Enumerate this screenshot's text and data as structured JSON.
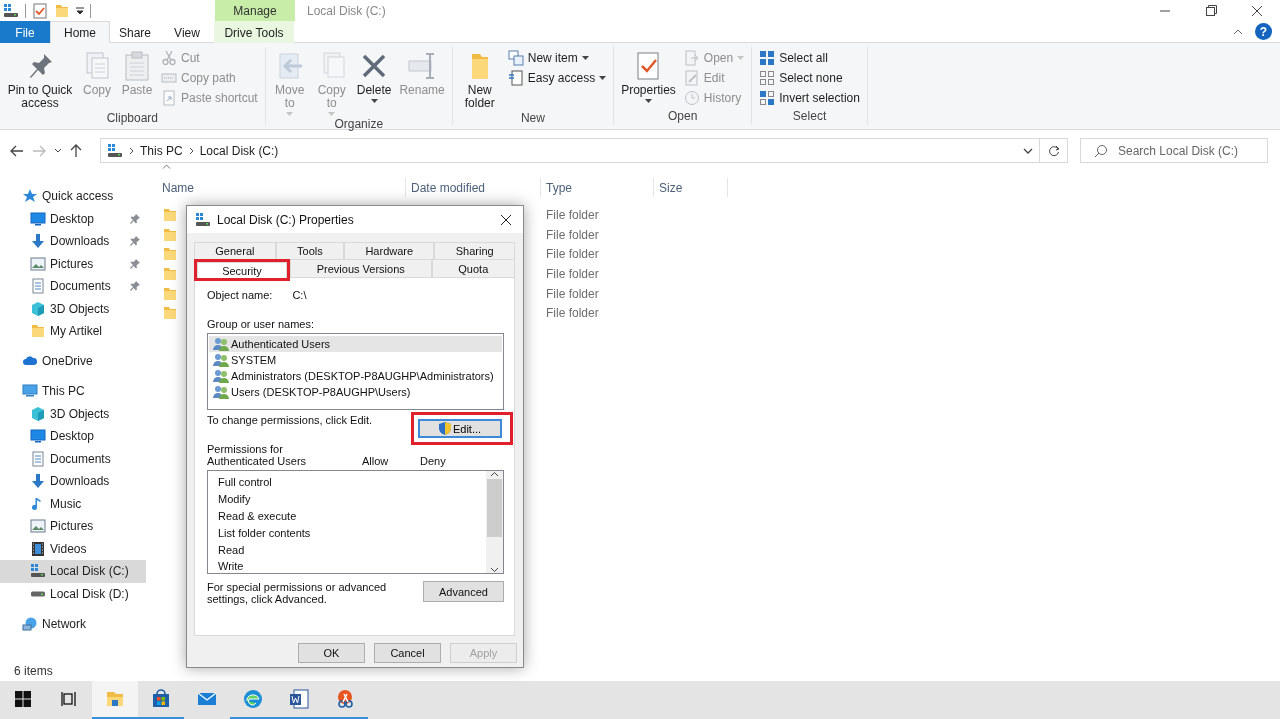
{
  "title_bar": {
    "title": "Local Disk (C:)",
    "context_group": "Manage"
  },
  "ribbon_tabs": [
    {
      "label": "File",
      "kind": "file",
      "selected": false
    },
    {
      "label": "Home",
      "kind": "normal",
      "selected": true
    },
    {
      "label": "Share",
      "kind": "normal",
      "selected": false
    },
    {
      "label": "View",
      "kind": "normal",
      "selected": false
    },
    {
      "label": "Drive Tools",
      "kind": "context",
      "selected": false
    }
  ],
  "help_button": "?",
  "ribbon_groups": [
    {
      "label": "Clipboard",
      "commands": [
        {
          "label": "Pin to Quick access",
          "kind": "large",
          "disabled": false,
          "dropdown": false
        },
        {
          "label": "Copy",
          "kind": "large",
          "disabled": true,
          "dropdown": false
        },
        {
          "label": "Paste",
          "kind": "large",
          "disabled": true,
          "dropdown": false
        },
        {
          "label": "Cut",
          "kind": "small",
          "disabled": true,
          "dropdown": false
        },
        {
          "label": "Copy path",
          "kind": "small",
          "disabled": true,
          "dropdown": false
        },
        {
          "label": "Paste shortcut",
          "kind": "small",
          "disabled": true,
          "dropdown": false
        }
      ]
    },
    {
      "label": "Organize",
      "commands": [
        {
          "label": "Move to",
          "kind": "large",
          "disabled": true,
          "dropdown": true
        },
        {
          "label": "Copy to",
          "kind": "large",
          "disabled": true,
          "dropdown": true
        },
        {
          "label": "Delete",
          "kind": "large",
          "disabled": false,
          "dropdown": true
        },
        {
          "label": "Rename",
          "kind": "large",
          "disabled": true,
          "dropdown": false
        }
      ]
    },
    {
      "label": "New",
      "commands": [
        {
          "label": "New folder",
          "kind": "large",
          "disabled": false,
          "dropdown": false
        },
        {
          "label": "New item",
          "kind": "small",
          "disabled": false,
          "dropdown": true
        },
        {
          "label": "Easy access",
          "kind": "small",
          "disabled": false,
          "dropdown": true
        }
      ]
    },
    {
      "label": "Open",
      "commands": [
        {
          "label": "Properties",
          "kind": "large",
          "disabled": false,
          "dropdown": true
        },
        {
          "label": "Open",
          "kind": "small",
          "disabled": true,
          "dropdown": true
        },
        {
          "label": "Edit",
          "kind": "small",
          "disabled": true,
          "dropdown": false
        },
        {
          "label": "History",
          "kind": "small",
          "disabled": true,
          "dropdown": false
        }
      ]
    },
    {
      "label": "Select",
      "commands": [
        {
          "label": "Select all",
          "kind": "small",
          "disabled": false,
          "dropdown": false
        },
        {
          "label": "Select none",
          "kind": "small",
          "disabled": false,
          "dropdown": false
        },
        {
          "label": "Invert selection",
          "kind": "small",
          "disabled": false,
          "dropdown": false
        }
      ]
    }
  ],
  "address_bar": {
    "breadcrumbs": [
      "This PC",
      "Local Disk (C:)"
    ]
  },
  "search": {
    "placeholder": "Search Local Disk (C:)"
  },
  "nav": {
    "items": [
      {
        "label": "Quick access",
        "selected": false,
        "children": [
          {
            "label": "Desktop",
            "selected": false,
            "pinned": true
          },
          {
            "label": "Downloads",
            "selected": false,
            "pinned": true
          },
          {
            "label": "Pictures",
            "selected": false,
            "pinned": true
          },
          {
            "label": "Documents",
            "selected": false,
            "pinned": true
          },
          {
            "label": "3D Objects",
            "selected": false,
            "pinned": false
          },
          {
            "label": "My Artikel",
            "selected": false,
            "pinned": false
          }
        ]
      },
      {
        "label": "OneDrive",
        "selected": false
      },
      {
        "label": "This PC",
        "selected": false,
        "children": [
          {
            "label": "3D Objects",
            "selected": false
          },
          {
            "label": "Desktop",
            "selected": false
          },
          {
            "label": "Documents",
            "selected": false
          },
          {
            "label": "Downloads",
            "selected": false
          },
          {
            "label": "Music",
            "selected": false
          },
          {
            "label": "Pictures",
            "selected": false
          },
          {
            "label": "Videos",
            "selected": false
          },
          {
            "label": "Local Disk (C:)",
            "selected": true
          },
          {
            "label": "Local Disk (D:)",
            "selected": false
          }
        ]
      },
      {
        "label": "Network",
        "selected": false
      }
    ]
  },
  "file_list": {
    "columns": [
      "Name",
      "Date modified",
      "Type",
      "Size"
    ],
    "rows": [
      {
        "type": "File folder"
      },
      {
        "type": "File folder"
      },
      {
        "type": "File folder"
      },
      {
        "type": "File folder"
      },
      {
        "type": "File folder"
      },
      {
        "type": "File folder"
      }
    ]
  },
  "status_bar": {
    "item_count": "6 items"
  },
  "dialog": {
    "title": "Local Disk (C:) Properties",
    "tab_rows": [
      {
        "tabs": [
          {
            "label": "General",
            "selected": false,
            "highlighted": false
          },
          {
            "label": "Tools",
            "selected": false,
            "highlighted": false
          },
          {
            "label": "Hardware",
            "selected": false,
            "highlighted": false
          },
          {
            "label": "Sharing",
            "selected": false,
            "highlighted": false
          }
        ]
      },
      {
        "tabs": [
          {
            "label": "Security",
            "selected": true,
            "highlighted": true
          },
          {
            "label": "Previous Versions",
            "selected": false,
            "highlighted": false
          },
          {
            "label": "Quota",
            "selected": false,
            "highlighted": false
          }
        ]
      }
    ],
    "object_name_label": "Object name:",
    "object_name": "C:\\",
    "users_label": "Group or user names:",
    "users": [
      {
        "name": "Authenticated Users",
        "selected": true
      },
      {
        "name": "SYSTEM",
        "selected": false
      },
      {
        "name": "Administrators (DESKTOP-P8AUGHP\\Administrators)",
        "selected": false
      },
      {
        "name": "Users (DESKTOP-P8AUGHP\\Users)",
        "selected": false
      }
    ],
    "edit_hint": "To change permissions, click Edit.",
    "edit_button": {
      "label": "Edit...",
      "highlighted": true
    },
    "permissions_label": "Permissions for Authenticated Users",
    "permission_columns": [
      "Allow",
      "Deny"
    ],
    "permissions": [
      {
        "name": "Full control"
      },
      {
        "name": "Modify"
      },
      {
        "name": "Read & execute"
      },
      {
        "name": "List folder contents"
      },
      {
        "name": "Read"
      },
      {
        "name": "Write"
      }
    ],
    "advanced_hint": "For special permissions or advanced settings, click Advanced.",
    "advanced_button": "Advanced",
    "buttons": [
      {
        "label": "OK",
        "disabled": false
      },
      {
        "label": "Cancel",
        "disabled": false
      },
      {
        "label": "Apply",
        "disabled": true
      }
    ]
  },
  "taskbar": {
    "apps": [
      {
        "running": true,
        "active": true
      },
      {
        "running": true,
        "active": false
      },
      {
        "running": false,
        "active": false
      },
      {
        "running": true,
        "active": false
      },
      {
        "running": true,
        "active": false
      },
      {
        "running": true,
        "active": false
      }
    ]
  }
}
